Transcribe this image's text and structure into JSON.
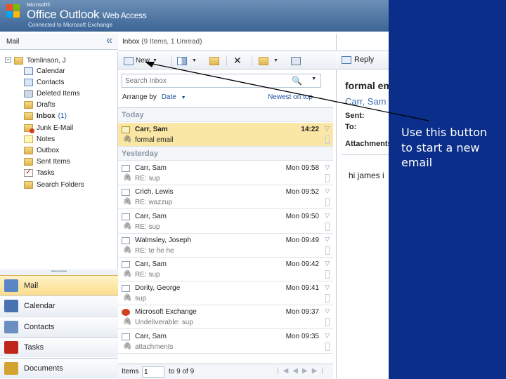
{
  "header": {
    "brand_small": "Microsoft®",
    "brand_office": "Office Outlook",
    "brand_owa": "Web Access",
    "subtitle": "Connected to Microsoft Exchange",
    "logo_colors": [
      "#f25022",
      "#7fba00",
      "#00a4ef",
      "#ffb900"
    ]
  },
  "left": {
    "heading": "Mail",
    "collapse_glyph": "«",
    "tree_toggle": "−",
    "mailbox_owner": "Tomlinson, J",
    "folders": [
      {
        "label": "Calendar",
        "icon": "calendar-icon"
      },
      {
        "label": "Contacts",
        "icon": "contacts-icon"
      },
      {
        "label": "Deleted Items",
        "icon": "trash-icon"
      },
      {
        "label": "Drafts",
        "icon": "folder-icon"
      },
      {
        "label": "Inbox",
        "icon": "folder-icon",
        "unread": "(1)"
      },
      {
        "label": "Junk E-Mail",
        "icon": "junk-icon"
      },
      {
        "label": "Notes",
        "icon": "notes-icon"
      },
      {
        "label": "Outbox",
        "icon": "folder-icon"
      },
      {
        "label": "Sent Items",
        "icon": "folder-icon"
      },
      {
        "label": "Tasks",
        "icon": "tasks-icon"
      },
      {
        "label": "Search Folders",
        "icon": "folder-icon"
      }
    ],
    "dots": "••••••••",
    "nav": [
      {
        "label": "Mail",
        "icon": "mail-icon",
        "color": "#5a86c5"
      },
      {
        "label": "Calendar",
        "icon": "calendar-icon",
        "color": "#4a72b0"
      },
      {
        "label": "Contacts",
        "icon": "contacts-icon",
        "color": "#6b8fc0"
      },
      {
        "label": "Tasks",
        "icon": "tasks-icon",
        "color": "#c0271c"
      },
      {
        "label": "Documents",
        "icon": "documents-icon",
        "color": "#d4a32f"
      }
    ]
  },
  "mid": {
    "title": "Inbox",
    "count": "(9 Items, 1 Unread)",
    "toolbar": {
      "new_label": "New"
    },
    "search_placeholder": "Search Inbox",
    "arrange_label": "Arrange by",
    "arrange_value": "Date",
    "sort_order": "Newest on top",
    "groups": {
      "today": "Today",
      "yesterday": "Yesterday"
    },
    "messages": [
      {
        "sender": "Carr, Sam",
        "time": "14:22",
        "subject": "formal email",
        "unread": true,
        "selected": true,
        "kind": "new"
      },
      {
        "sender": "Carr, Sam",
        "time": "Mon 09:58",
        "subject": "RE: sup",
        "kind": "reply"
      },
      {
        "sender": "Crich, Lewis",
        "time": "Mon 09:52",
        "subject": "RE: wazzup",
        "kind": "reply"
      },
      {
        "sender": "Carr, Sam",
        "time": "Mon 09:50",
        "subject": "RE: sup",
        "kind": "reply"
      },
      {
        "sender": "Walmsley, Joseph",
        "time": "Mon 09:49",
        "subject": "RE: te he he",
        "kind": "reply"
      },
      {
        "sender": "Carr, Sam",
        "time": "Mon 09:42",
        "subject": "RE: sup",
        "kind": "reply"
      },
      {
        "sender": "Dority, George",
        "time": "Mon 09:41",
        "subject": "sup",
        "kind": "reply"
      },
      {
        "sender": "Microsoft Exchange",
        "time": "Mon 09:37",
        "subject": "Undeliverable: sup",
        "kind": "ndr"
      },
      {
        "sender": "Carr, Sam",
        "time": "Mon 09:35",
        "subject": "attachments",
        "kind": "reply"
      }
    ],
    "pager": {
      "label": "Items",
      "value": "1",
      "of": "to 9 of 9"
    }
  },
  "reading": {
    "reply": "Reply",
    "subject": "formal email",
    "from": "Carr, Sam",
    "sent_label": "Sent:",
    "to_label": "To:",
    "attachments_label": "Attachments:",
    "body": "hi james i"
  },
  "overlay": {
    "text": "Use this button to start a new email",
    "color": "#0a2e8a"
  }
}
